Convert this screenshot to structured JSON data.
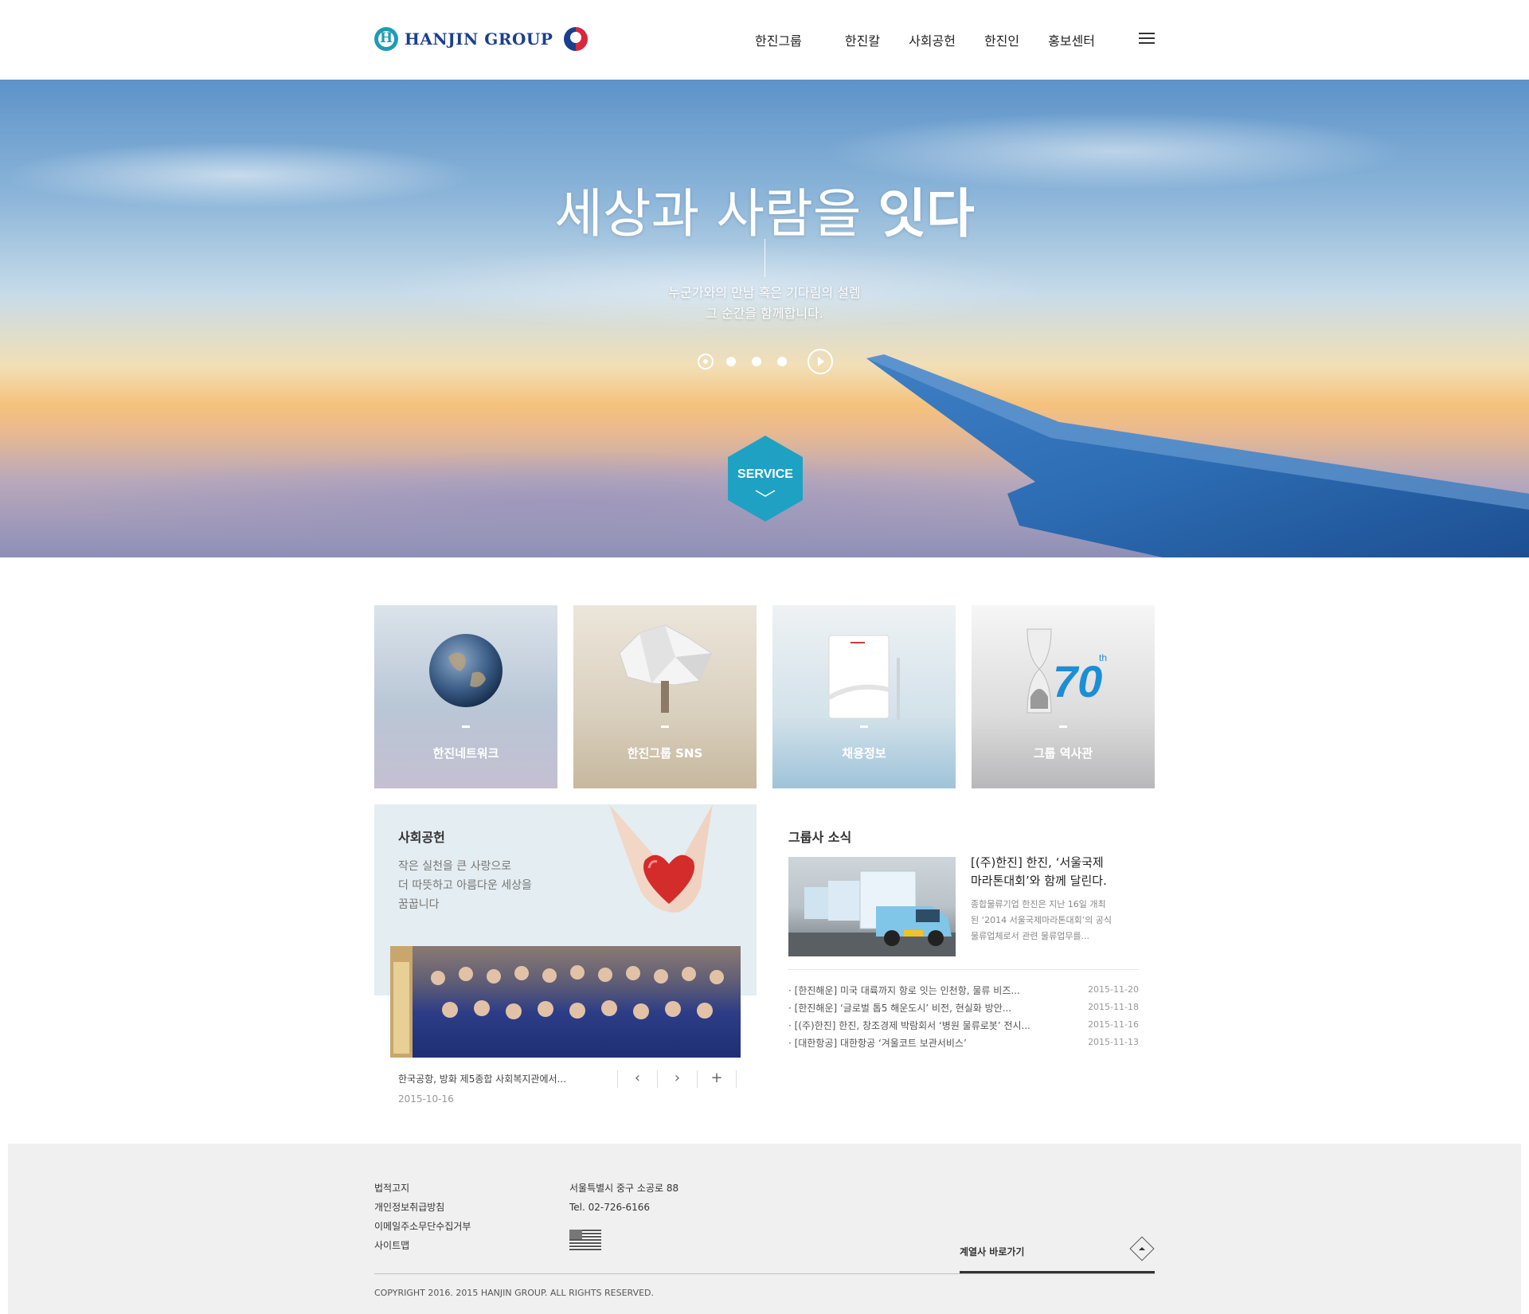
{
  "header": {
    "logo_text": "HANJIN GROUP",
    "nav": [
      "한진그룹",
      "한진칼",
      "사회공헌",
      "한진인",
      "홍보센터"
    ]
  },
  "hero": {
    "title_light": "세상과 사람을 ",
    "title_bold": "잇다",
    "subtitle": [
      "누군가와의 만남 혹은 기다림의 설렘",
      "그 순간을 함께합니다."
    ],
    "slide_count": 4,
    "active_slide": 1,
    "service_label": "SERVICE"
  },
  "tiles": [
    {
      "label": "한진네트워크"
    },
    {
      "label": "한진그룹 SNS"
    },
    {
      "label": "채용정보"
    },
    {
      "label": "그룹 역사관"
    }
  ],
  "social": {
    "title": "사회공헌",
    "text": [
      "작은 실천을 큰 사랑으로",
      "더 따뜻하고 아름다운 세상을",
      "꿈꿉니다"
    ],
    "caption": "한국공항, 방화 제5종합 사회복지관에서...",
    "date": "2015-10-16",
    "controls": [
      "‹",
      "›",
      "+"
    ]
  },
  "news": {
    "title": "그룹사 소식",
    "headline": [
      "[(주)한진] 한진, ‘서울국제",
      "마라톤대회’와 함께 달린다."
    ],
    "desc": [
      "종합물류기업 한진은 지난 16일 개최",
      "된 ‘2014 서울국제마라톤대회’의 공식",
      "물류업체로서 관련 물류업무를..."
    ],
    "items": [
      {
        "text": "[한진해운] 미국 대륙까지 항로 잇는 인천항, 물류 비즈...",
        "date": "2015-11-20"
      },
      {
        "text": "[한진해운] ‘글로벌 톱5 해운도시’ 비전, 현실화 방안...",
        "date": "2015-11-18"
      },
      {
        "text": "[(주)한진] 한진, 창조경제 박람회서 ‘병원 물류로봇’ 전시...",
        "date": "2015-11-16"
      },
      {
        "text": "[대한항공] 대한항공 ‘겨울코트 보관서비스’",
        "date": "2015-11-13"
      }
    ]
  },
  "footer": {
    "links": [
      "법적고지",
      "개인정보취급방침",
      "이메일주소무단수집거부",
      "사이트맵"
    ],
    "address": "서울특별시 중구 소공로 88",
    "tel": "Tel. 02-726-6166",
    "family_label": "계열사 바로가기",
    "copyright": "COPYRIGHT 2016. 2015 HANJIN GROUP. ALL RIGHTS RESERVED."
  },
  "colors": {
    "brand_navy": "#1b3f8f",
    "brand_teal": "#1f9bb6",
    "service_hex": "#1fa1c4",
    "footer_bg": "#f0f0f0"
  }
}
